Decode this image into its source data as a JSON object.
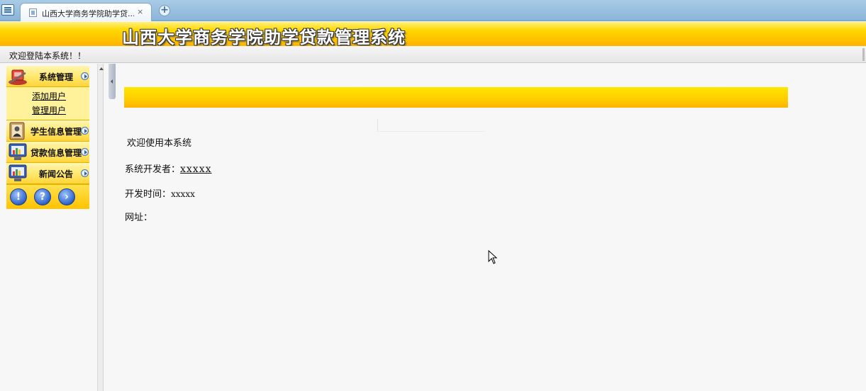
{
  "browser": {
    "tab_title": "山西大学商务学院助学贷...",
    "tab_close": "×",
    "new_tab": "+"
  },
  "banner": {
    "title": "山西大学商务学院助学贷款管理系统"
  },
  "welcome_bar": {
    "text": "欢迎登陆本系统！！"
  },
  "sidebar": {
    "menus": [
      {
        "label": "系统管理",
        "icon": "wrench-tools-icon",
        "expanded": true,
        "items": [
          {
            "label": "添加用户"
          },
          {
            "label": "管理用户"
          }
        ]
      },
      {
        "label": "学生信息管理",
        "icon": "student-card-icon"
      },
      {
        "label": "贷款信息管理",
        "icon": "monitor-chart-icon"
      },
      {
        "label": "新闻公告",
        "icon": "monitor-chart-icon"
      }
    ],
    "footer_buttons": [
      {
        "icon": "info-icon",
        "glyph": "!"
      },
      {
        "icon": "help-icon",
        "glyph": "?"
      },
      {
        "icon": "forward-icon",
        "glyph": "›"
      }
    ]
  },
  "main": {
    "welcome": "欢迎使用本系统",
    "developer_label": "系统开发者：",
    "developer_value": "xxxxx",
    "dev_time_label": "开发时间：",
    "dev_time_value": "xxxxx",
    "url_label": "网址："
  },
  "colors": {
    "accent_yellow": "#ffd700",
    "accent_orange": "#ffb300",
    "tabstrip_blue": "#8ab4d8"
  }
}
